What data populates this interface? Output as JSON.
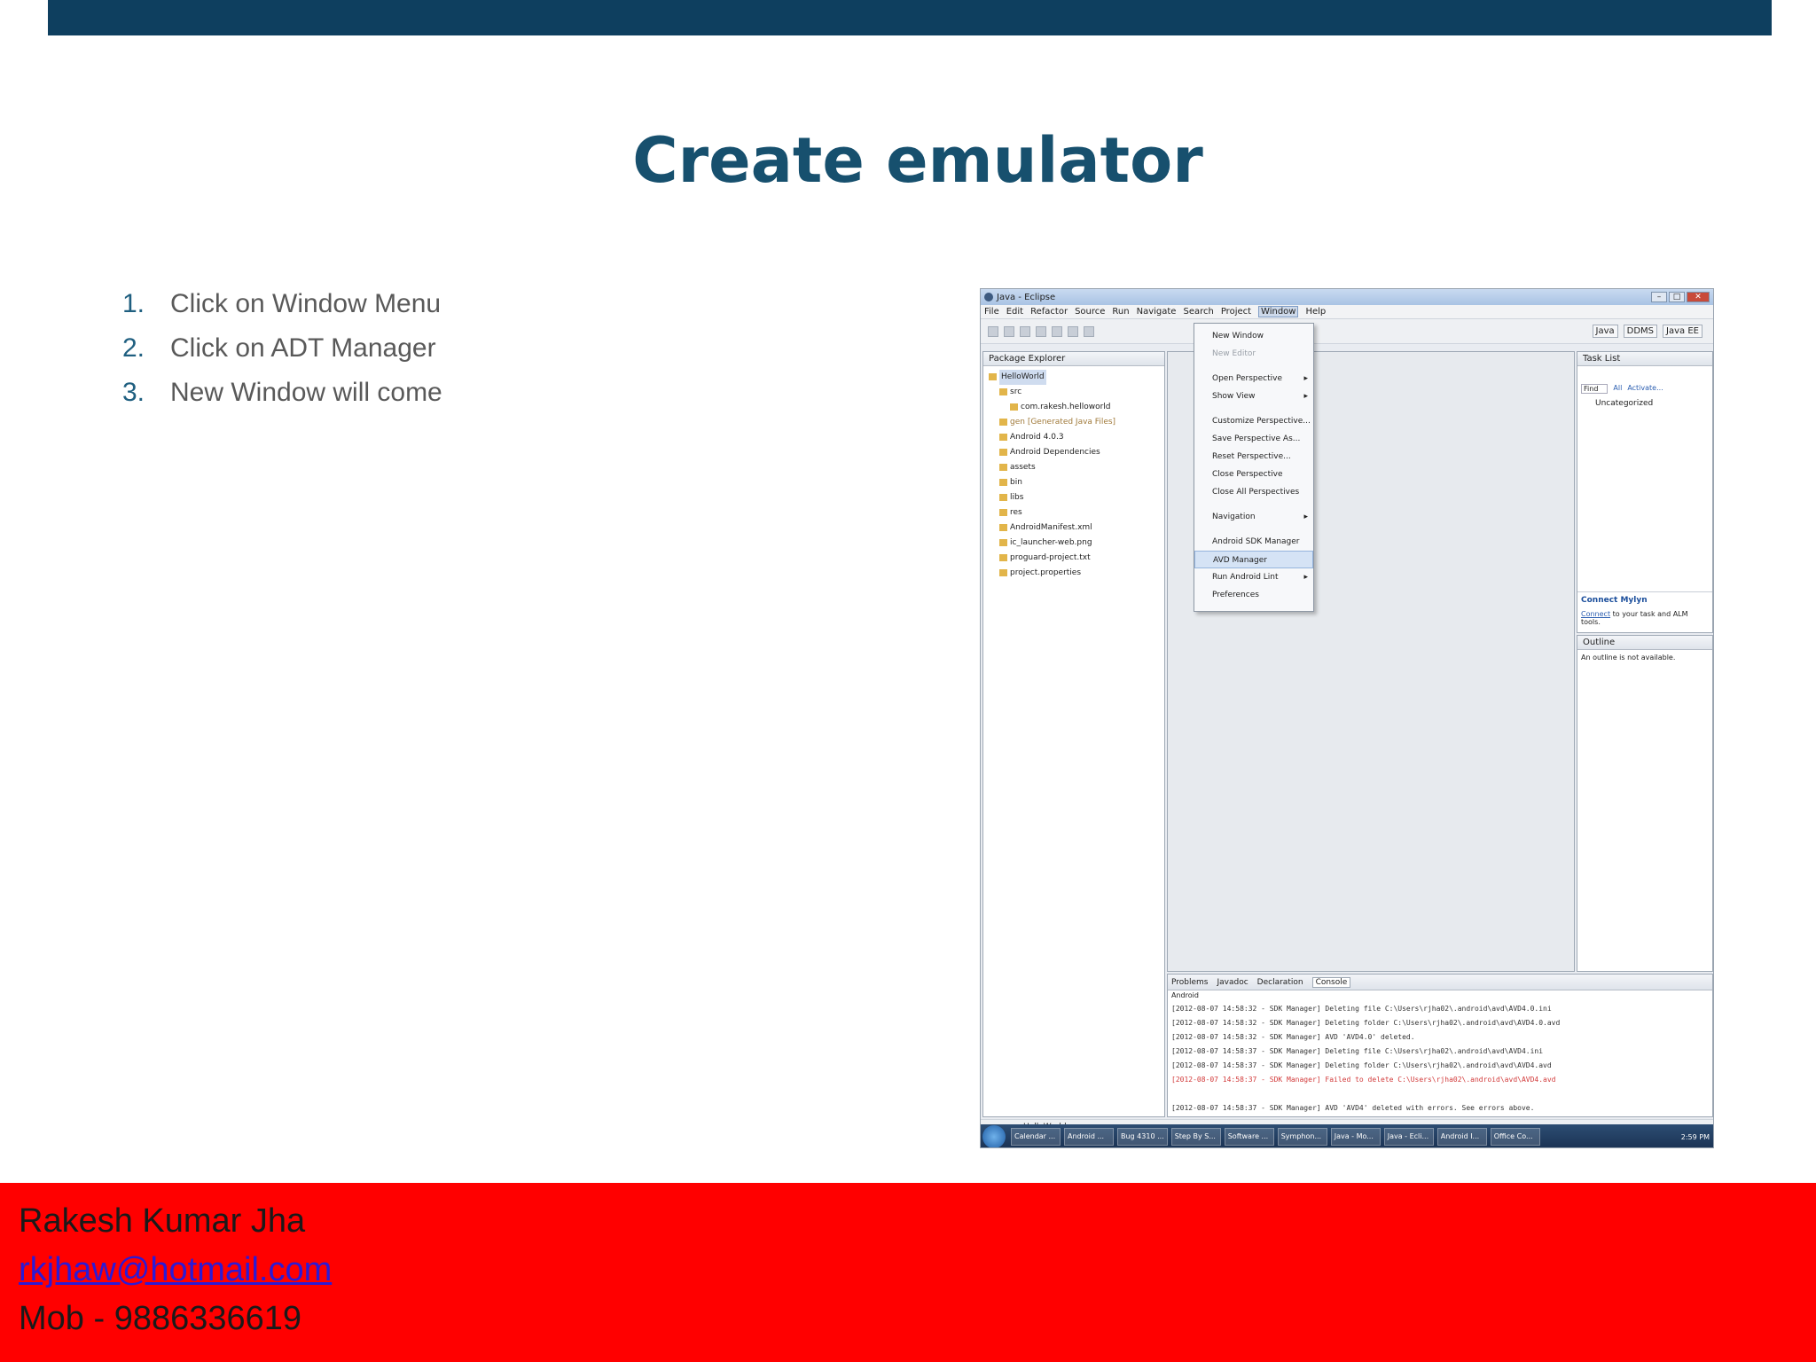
{
  "slide": {
    "title": "Create emulator",
    "steps": [
      {
        "num": "1.",
        "text": "Click on Window Menu"
      },
      {
        "num": "2.",
        "text": "Click on ADT Manager"
      },
      {
        "num": "3.",
        "text": "New Window will come"
      }
    ]
  },
  "footer": {
    "name": "Rakesh Kumar Jha",
    "email": "rkjhaw@hotmail.com",
    "phone": "Mob - 9886336619"
  },
  "colors": {
    "top_bar": "#0e3f5f",
    "title": "#17506e",
    "footer_bg": "#ff0000"
  },
  "eclipse": {
    "window_title": "Java - Eclipse",
    "menu": [
      "File",
      "Edit",
      "Refactor",
      "Source",
      "Run",
      "Navigate",
      "Search",
      "Project",
      "Window",
      "Help"
    ],
    "perspectives": [
      "Java",
      "DDMS",
      "Java EE"
    ],
    "package_explorer": {
      "title": "Package Explorer",
      "items": [
        "HelloWorld",
        "src",
        "com.rakesh.helloworld",
        "gen [Generated Java Files]",
        "Android 4.0.3",
        "Android Dependencies",
        "assets",
        "bin",
        "libs",
        "res",
        "AndroidManifest.xml",
        "ic_launcher-web.png",
        "proguard-project.txt",
        "project.properties"
      ]
    },
    "window_menu": {
      "items": [
        "New Window",
        "New Editor",
        "Open Perspective",
        "Show View",
        "Customize Perspective...",
        "Save Perspective As...",
        "Reset Perspective...",
        "Close Perspective",
        "Close All Perspectives",
        "Navigation",
        "Android SDK Manager",
        "AVD Manager",
        "Run Android Lint",
        "Preferences"
      ]
    },
    "task_list": {
      "title": "Task List",
      "find": "Find",
      "all": "All",
      "activate": "Activate...",
      "uncategorized": "Uncategorized",
      "mylyn_title": "Connect Mylyn",
      "mylyn_link": "Connect",
      "mylyn_text": "to your task and ALM tools."
    },
    "outline": {
      "title": "Outline",
      "message": "An outline is not available."
    },
    "console": {
      "tabs": [
        "Problems",
        "Javadoc",
        "Declaration",
        "Console"
      ],
      "label": "Android",
      "lines": [
        "[2012-08-07 14:58:32 - SDK Manager] Deleting file C:\\Users\\rjha02\\.android\\avd\\AVD4.0.ini",
        "[2012-08-07 14:58:32 - SDK Manager] Deleting folder C:\\Users\\rjha02\\.android\\avd\\AVD4.0.avd",
        "[2012-08-07 14:58:32 - SDK Manager] AVD 'AVD4.0' deleted.",
        "[2012-08-07 14:58:37 - SDK Manager] Deleting file C:\\Users\\rjha02\\.android\\avd\\AVD4.ini",
        "[2012-08-07 14:58:37 - SDK Manager] Deleting folder C:\\Users\\rjha02\\.android\\avd\\AVD4.avd",
        "[2012-08-07 14:58:37 - SDK Manager] Failed to delete C:\\Users\\rjha02\\.android\\avd\\AVD4.avd",
        "",
        "[2012-08-07 14:58:37 - SDK Manager] AVD 'AVD4' deleted with errors. See errors above."
      ]
    },
    "status_text": "HelloWorld",
    "taskbar": [
      "Calendar ...",
      "Android ...",
      "Bug 4310 ...",
      "Step By S...",
      "Software ...",
      "Symphon...",
      "Java - Mo...",
      "Java - Ecli...",
      "Android I...",
      "Office Co..."
    ],
    "clock": "2:59 PM"
  }
}
